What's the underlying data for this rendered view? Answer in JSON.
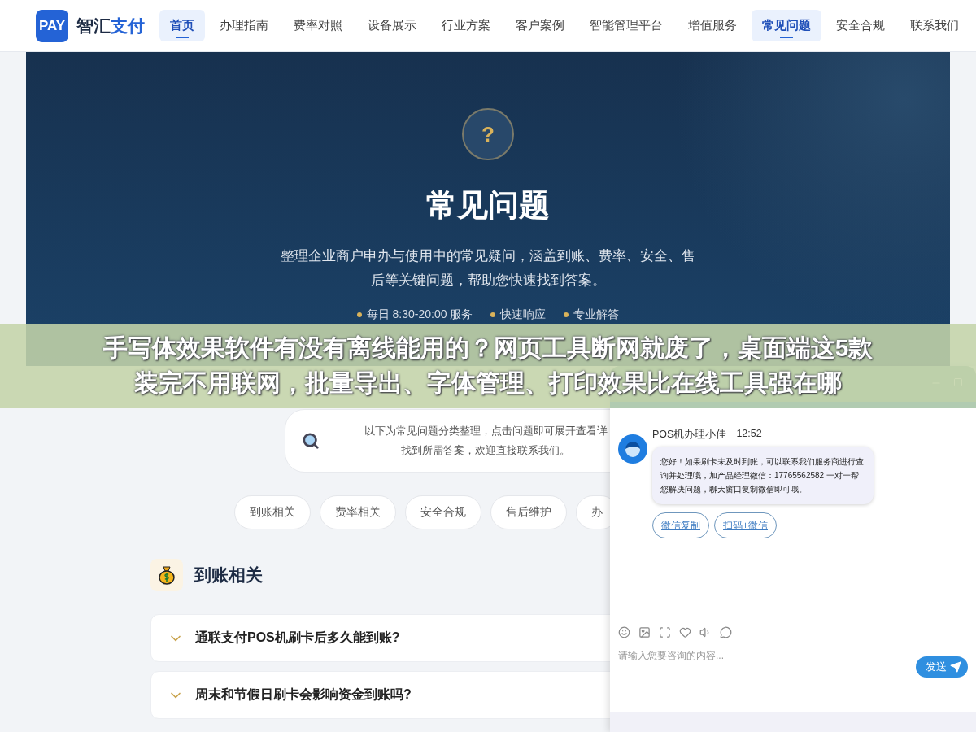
{
  "logo": {
    "badge": "PAY",
    "name": "智汇",
    "name_accent": "支付"
  },
  "nav": [
    {
      "label": "首页",
      "selected": true
    },
    {
      "label": "办理指南",
      "selected": false
    },
    {
      "label": "费率对照",
      "selected": false
    },
    {
      "label": "设备展示",
      "selected": false
    },
    {
      "label": "行业方案",
      "selected": false
    },
    {
      "label": "客户案例",
      "selected": false
    },
    {
      "label": "智能管理平台",
      "selected": false
    },
    {
      "label": "增值服务",
      "selected": false
    },
    {
      "label": "常见问题",
      "selected": true
    },
    {
      "label": "安全合规",
      "selected": false
    },
    {
      "label": "联系我们",
      "selected": false
    }
  ],
  "hero": {
    "icon_text": "?",
    "title": "常见问题",
    "description": "整理企业商户申办与使用中的常见疑问，涵盖到账、费率、安全、售后等关键问题，帮助您快速找到答案。",
    "features": [
      "每日 8:30-20:00 服务",
      "快速响应",
      "专业解答"
    ]
  },
  "banner": {
    "lines": [
      "手写体效果软件有没有离线能用的？网页工具断网就废了，桌面端这5款",
      "装完不用联网，批量导出、字体管理、打印效果比在线工具强在哪"
    ]
  },
  "notice": {
    "lines": [
      "以下为常见问题分类整理，点击问题即可展开查看详",
      "找到所需答案，欢迎直接联系我们。"
    ]
  },
  "categories": [
    {
      "label": "到账相关",
      "selected": false
    },
    {
      "label": "费率相关",
      "selected": false
    },
    {
      "label": "安全合规",
      "selected": false
    },
    {
      "label": "售后维护",
      "selected": false
    },
    {
      "label": "办",
      "selected": false
    }
  ],
  "section": {
    "title": "到账相关",
    "questions": [
      {
        "text": "通联支付POS机刷卡后多久能到账?",
        "expanded": false
      },
      {
        "text": "周末和节假日刷卡会影响资金到账吗?",
        "expanded": false
      }
    ]
  },
  "chat": {
    "agent": "POS机办理小佳",
    "time": "12:52",
    "message": "您好！如果刷卡未及时到账，可以联系我们服务商进行查询并处理哦，加产品经理微信：17765562582 一对一帮您解决问题，聊天窗口复制微信即可哦。",
    "actions": [
      "微信复制",
      "扫码+微信"
    ],
    "input": {
      "placeholder": "请输入您要咨询的内容..."
    },
    "send": "发送"
  }
}
